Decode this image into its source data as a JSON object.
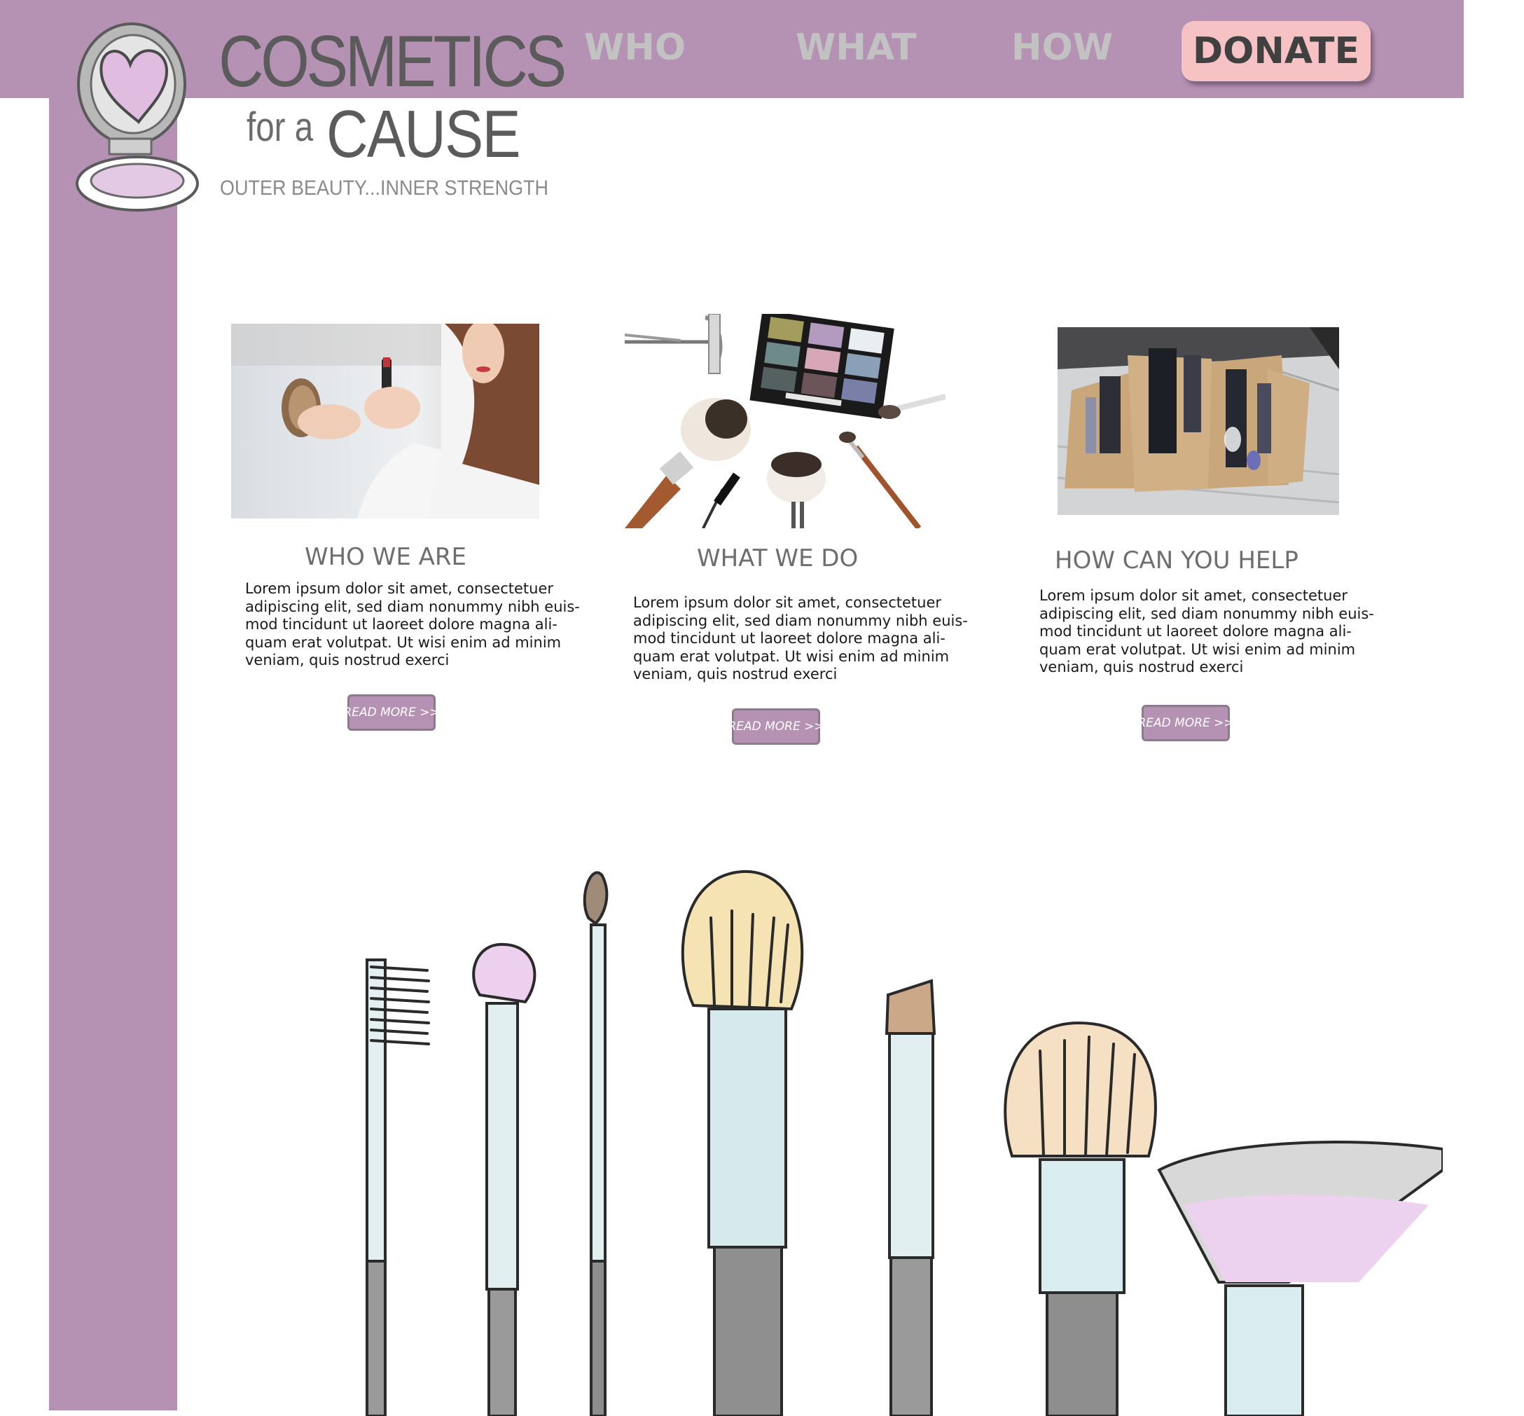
{
  "brand": {
    "title_line1": "COSMETICS",
    "title_for": "for a",
    "title_cause": "CAUSE",
    "tagline": "OUTER BEAUTY...INNER STRENGTH",
    "colors": {
      "primary": "#b592b3",
      "donate": "#f7c2c4",
      "nav_text": "#c2c2c2"
    }
  },
  "nav": {
    "who": "WHO",
    "what": "WHAT",
    "how": "HOW",
    "donate": "DONATE"
  },
  "cards": [
    {
      "title": "WHO WE ARE",
      "text": "Lorem ipsum dolor sit amet, consectetuer adipiscing elit, sed diam nonummy nibh euis-mod tincidunt ut laoreet dolore magna ali-quam erat volutpat. Ut wisi enim ad minim veniam, quis nostrud exerci",
      "button": "READ MORE >>"
    },
    {
      "title": "WHAT WE DO",
      "text": "Lorem ipsum dolor sit amet, consectetuer adipiscing elit, sed diam nonummy nibh euis-mod tincidunt ut laoreet dolore magna ali-quam erat volutpat. Ut wisi enim ad minim veniam, quis nostrud exerci",
      "button": "READ MORE >>"
    },
    {
      "title": "HOW CAN YOU HELP",
      "text": "Lorem ipsum dolor sit amet, consectetuer adipiscing elit, sed diam nonummy nibh euis-mod tincidunt ut laoreet dolore magna ali-quam erat volutpat. Ut wisi enim ad minim veniam, quis nostrud exerci",
      "button": "READ MORE >>"
    }
  ],
  "icons": [
    "compact-mirror-logo-icon",
    "makeup-brushes-illustration"
  ]
}
